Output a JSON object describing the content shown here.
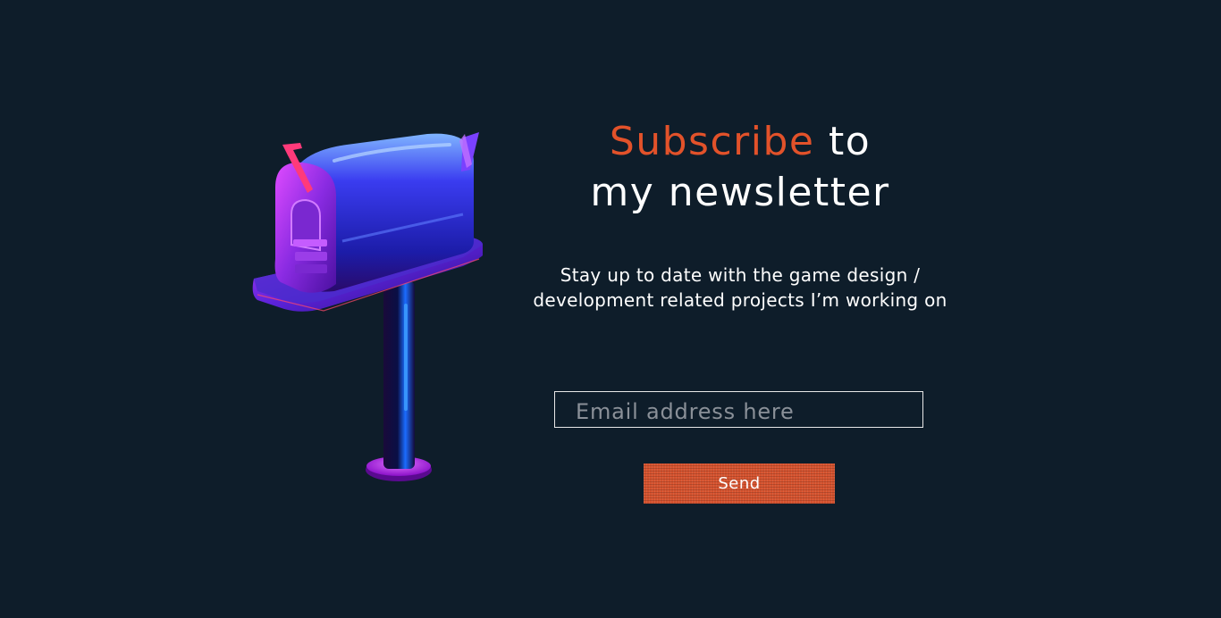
{
  "newsletter": {
    "heading_accent": "Subscribe",
    "heading_rest": "to",
    "heading_line2": "my newsletter",
    "subtitle": "Stay up to date with the game design / development related projects I’m working on",
    "email_placeholder": "Email address here",
    "send_label": "Send"
  },
  "illustration": {
    "icon": "mailbox-icon"
  },
  "colors": {
    "background": "#0e1d2a",
    "accent": "#e2522a",
    "button": "#d5522e",
    "text": "#ffffff",
    "placeholder": "#8a9098"
  }
}
